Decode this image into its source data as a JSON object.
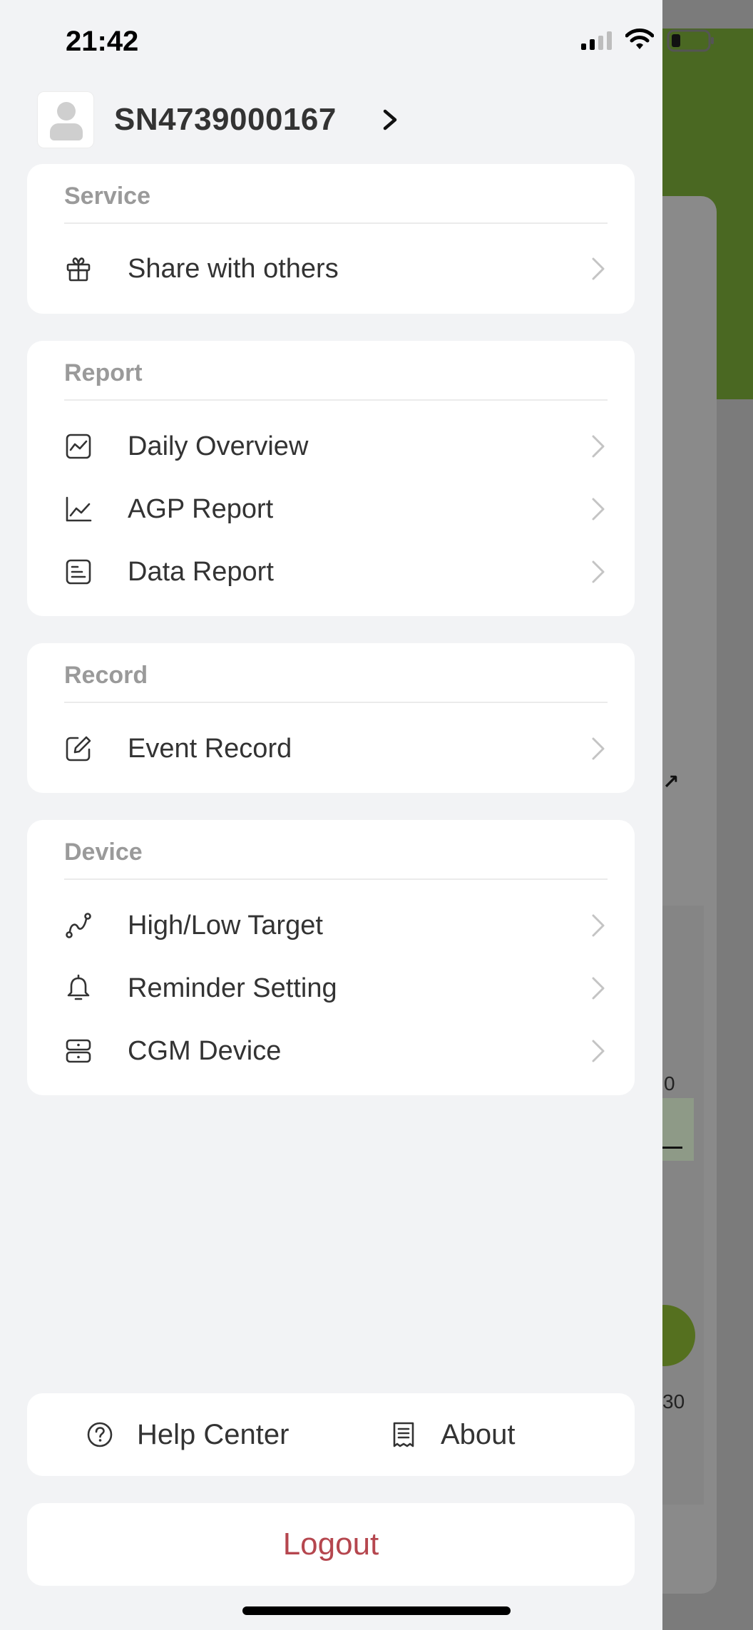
{
  "status_bar": {
    "time": "21:42"
  },
  "profile": {
    "name": "SN4739000167"
  },
  "sections": {
    "service": {
      "title": "Service",
      "items": [
        {
          "label": "Share with others",
          "icon": "gift-icon"
        }
      ]
    },
    "report": {
      "title": "Report",
      "items": [
        {
          "label": "Daily Overview",
          "icon": "line-chart-box-icon"
        },
        {
          "label": "AGP Report",
          "icon": "line-chart-icon"
        },
        {
          "label": "Data Report",
          "icon": "document-lines-icon"
        }
      ]
    },
    "record": {
      "title": "Record",
      "items": [
        {
          "label": "Event Record",
          "icon": "edit-icon"
        }
      ]
    },
    "device": {
      "title": "Device",
      "items": [
        {
          "label": "High/Low Target",
          "icon": "curve-target-icon"
        },
        {
          "label": "Reminder Setting",
          "icon": "bell-icon"
        },
        {
          "label": "CGM Device",
          "icon": "server-device-icon"
        }
      ]
    }
  },
  "footer": {
    "help_label": "Help Center",
    "about_label": "About",
    "logout_label": "Logout"
  },
  "background_app": {
    "text_1": "0",
    "text_2": "30"
  },
  "colors": {
    "accent_logout": "#b5464e",
    "brand_green": "#4a6822",
    "section_title": "#9a9a9a",
    "text_primary": "#333333"
  }
}
